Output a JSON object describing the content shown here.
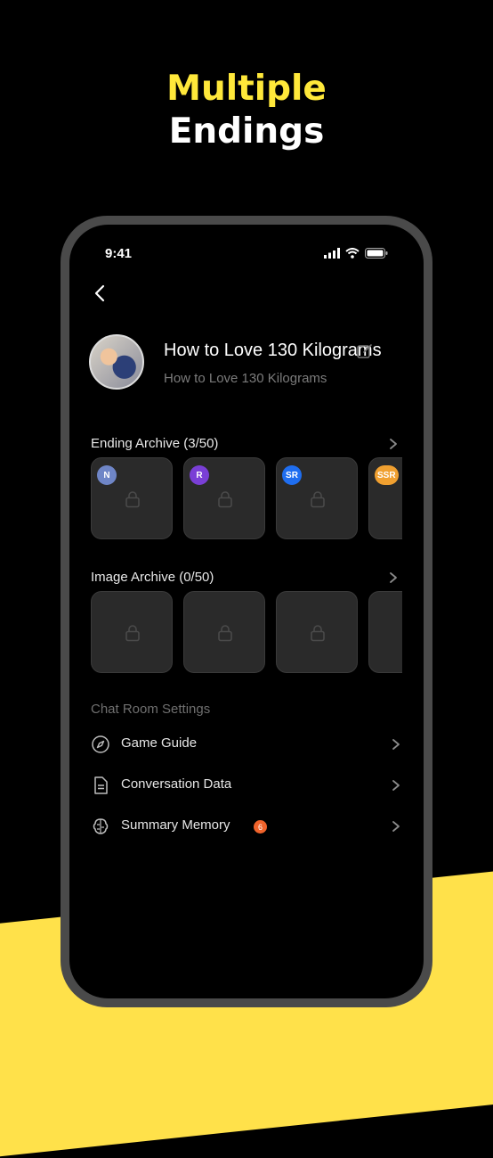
{
  "headline": {
    "line1": "Multiple",
    "line2": "Endings"
  },
  "status_bar": {
    "time": "9:41"
  },
  "character": {
    "name": "How to Love 130 Kilograms",
    "subtitle": "How to Love 130 Kilograms"
  },
  "ending_archive": {
    "title": "Ending Archive (3/50)",
    "cards": [
      {
        "badge": "N",
        "color": "#6f86c7"
      },
      {
        "badge": "R",
        "color": "#7a3fd6"
      },
      {
        "badge": "SR",
        "color": "#1f6ef0"
      },
      {
        "badge": "SSR",
        "color": "#f0a030"
      }
    ]
  },
  "image_archive": {
    "title": "Image Archive (0/50)"
  },
  "settings": {
    "title": "Chat Room Settings",
    "items": [
      {
        "label": "Game Guide",
        "icon": "compass-icon"
      },
      {
        "label": "Conversation Data",
        "icon": "document-icon"
      },
      {
        "label": "Summary Memory",
        "icon": "brain-icon",
        "badge": "6"
      }
    ]
  },
  "colors": {
    "accent_yellow": "#ffe83a",
    "band_yellow": "#ffe14a",
    "badge_orange": "#f0632b"
  }
}
